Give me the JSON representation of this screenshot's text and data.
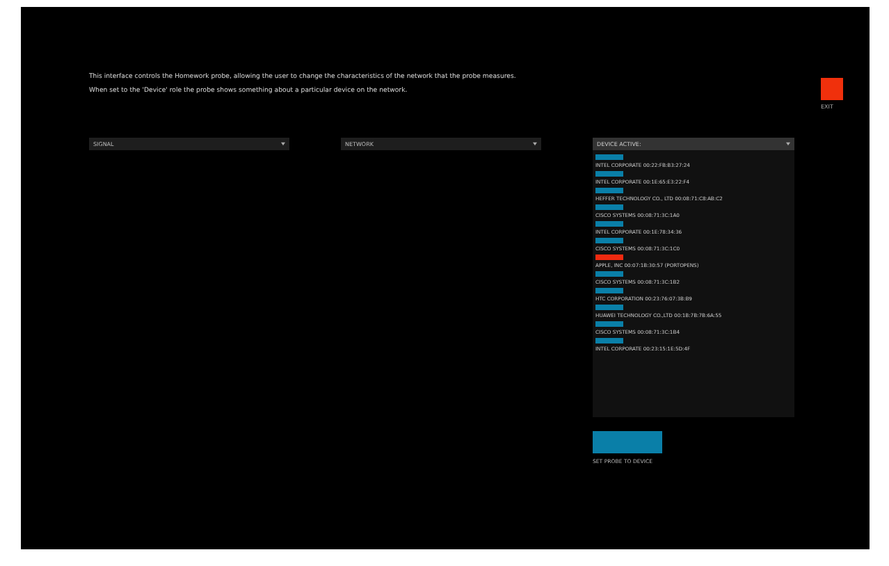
{
  "intro": [
    "This interface controls the Homework probe, allowing the user to change the characteristics of the network that the probe measures.",
    "When set to the 'Device' role the probe shows something about a particular device on the network."
  ],
  "exit": {
    "label": "EXIT"
  },
  "dropdowns": [
    {
      "value": "SIGNAL"
    },
    {
      "value": "NETWORK"
    }
  ],
  "device_list": {
    "title": "DEVICE ACTIVE:",
    "devices": [
      {
        "label": "INTEL CORPORATE 00:22:FB:B3:27:24",
        "color": "#0a7fa8"
      },
      {
        "label": "INTEL CORPORATE 00:1E:65:E3:22:F4",
        "color": "#0a7fa8"
      },
      {
        "label": "HEFFER TECHNOLOGY CO., LTD 00:08:71:C8:AB:C2",
        "color": "#0a7fa8"
      },
      {
        "label": "CISCO SYSTEMS 00:08:71:3C:1A0",
        "color": "#0a7fa8"
      },
      {
        "label": "INTEL CORPORATE 00:1E:78:34:36",
        "color": "#0a7fa8"
      },
      {
        "label": "CISCO SYSTEMS 00:08:71:3C:1C0",
        "color": "#0a7fa8"
      },
      {
        "label": "APPLE, INC 00:07:1B:30:57 (PORTOPENS)",
        "color": "#f02a10"
      },
      {
        "label": "CISCO SYSTEMS 00:08:71:3C:1B2",
        "color": "#0a7fa8"
      },
      {
        "label": "HTC CORPORATION 00:23:76:07:3B:B9",
        "color": "#0a7fa8"
      },
      {
        "label": "HUAWEI TECHNOLOGY CO.,LTD 00:1B:7B:7B:6A:55",
        "color": "#0a7fa8"
      },
      {
        "label": "CISCO SYSTEMS 00:08:71:3C:1B4",
        "color": "#0a7fa8"
      },
      {
        "label": "INTEL CORPORATE 00:23:15:1E:5D:4F",
        "color": "#0a7fa8"
      }
    ]
  },
  "action": {
    "label": "SET PROBE TO DEVICE"
  }
}
